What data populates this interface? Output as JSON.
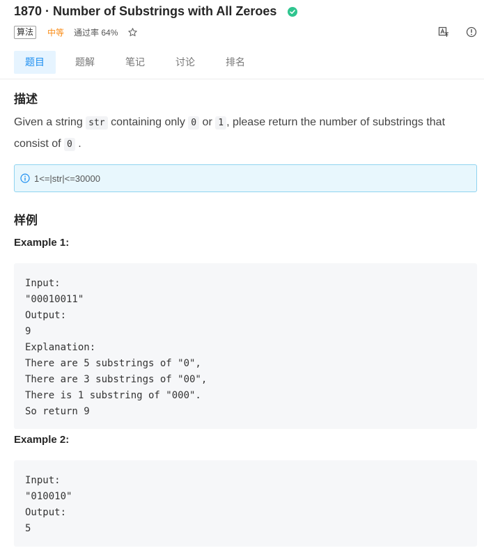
{
  "problem": {
    "title": "1870 · Number of Substrings with All Zeroes",
    "category_tag": "算法",
    "difficulty": "中等",
    "pass_rate": "通过率 64%"
  },
  "tabs": [
    {
      "label": "题目"
    },
    {
      "label": "题解"
    },
    {
      "label": "笔记"
    },
    {
      "label": "讨论"
    },
    {
      "label": "排名"
    }
  ],
  "description": {
    "heading": "描述",
    "text_1": "Given a string ",
    "code_1": "str",
    "text_2": " containing only ",
    "code_2": "0",
    "text_3": " or ",
    "code_3": "1",
    "text_4": ", please return the number of substrings that consist of ",
    "code_4": "0",
    "text_5": " ."
  },
  "note": {
    "text": "1<=|str|<=30000"
  },
  "examples": {
    "heading": "样例",
    "ex1_title": "Example 1:",
    "ex1_code": "Input:\n\"00010011\"\nOutput:\n9\nExplanation:\nThere are 5 substrings of \"0\",\nThere are 3 substrings of \"00\",\nThere is 1 substring of \"000\".\nSo return 9",
    "ex2_title": "Example 2:",
    "ex2_code": "Input:\n\"010010\"\nOutput:\n5"
  },
  "colors": {
    "accent": "#1a8df0",
    "difficulty": "#fa8c16",
    "check": "#2fc58f",
    "note_border": "#8fd3f0"
  },
  "icons": [
    "check-circle-icon",
    "star-icon",
    "translate-icon",
    "info-circle-icon"
  ]
}
